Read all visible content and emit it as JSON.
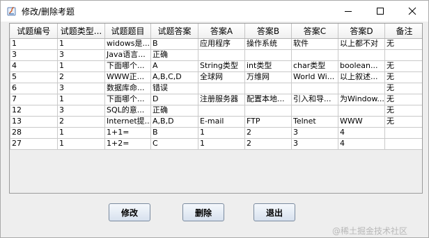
{
  "window": {
    "title": "修改/删除考题"
  },
  "table": {
    "headers": [
      "试题编号",
      "试题类型...",
      "试题题目",
      "试题答案",
      "答案A",
      "答案B",
      "答案C",
      "答案D",
      "备注"
    ],
    "rows": [
      [
        "1",
        "1",
        "widows是...",
        "B",
        "应用程序",
        "操作系统",
        "软件",
        "以上都不对",
        "无"
      ],
      [
        "3",
        "3",
        "Java语言...",
        "正确",
        "",
        "",
        "",
        "",
        ""
      ],
      [
        "4",
        "1",
        "下面哪个...",
        "A",
        "String类型",
        "int类型",
        "char类型",
        "boolean...",
        "无"
      ],
      [
        "5",
        "2",
        "WWW正...",
        "A,B,C,D",
        "全球网",
        "万维网",
        "World Wi...",
        "以上叙述...",
        "无"
      ],
      [
        "6",
        "3",
        "数据库命...",
        "错误",
        "",
        "",
        "",
        "",
        "无"
      ],
      [
        "7",
        "1",
        "下面哪个...",
        "D",
        "注册服务器",
        "配置本地...",
        "引入和导...",
        "为Window...",
        "无"
      ],
      [
        "12",
        "3",
        "SQL的意...",
        "正确",
        "",
        "",
        "",
        "",
        "无"
      ],
      [
        "13",
        "2",
        "Internet提...",
        "A,B,D",
        "E-mail",
        "FTP",
        "Telnet",
        "WWW",
        "无"
      ],
      [
        "28",
        "1",
        "1+1=",
        "B",
        "1",
        "2",
        "3",
        "4",
        ""
      ],
      [
        "27",
        "1",
        "1+2=",
        "C",
        "1",
        "2",
        "3",
        "4",
        ""
      ]
    ]
  },
  "buttons": {
    "modify": "修改",
    "delete": "删除",
    "exit": "退出"
  },
  "watermark": "@稀土掘金技术社区"
}
